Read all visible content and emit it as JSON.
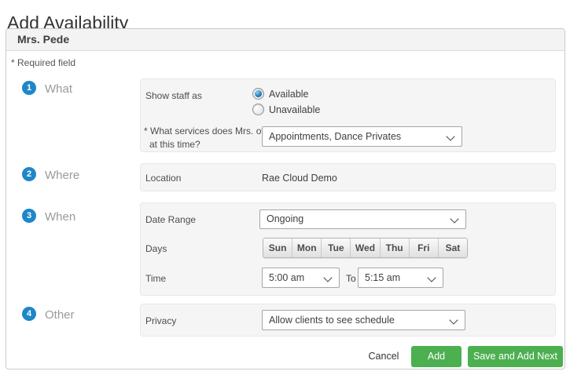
{
  "page": {
    "title": "Add Availability"
  },
  "panel": {
    "header_title": "Mrs. Pede",
    "required_note": "* Required field",
    "sections": [
      {
        "number": "1",
        "label": "What"
      },
      {
        "number": "2",
        "label": "Where"
      },
      {
        "number": "3",
        "label": "When"
      },
      {
        "number": "4",
        "label": "Other"
      }
    ]
  },
  "what": {
    "show_staff_label": "Show staff as",
    "options": [
      {
        "label": "Available",
        "selected": true
      },
      {
        "label": "Unavailable",
        "selected": false
      }
    ],
    "services_question_line1": "* What services does Mrs. offer",
    "services_question_line2": "at this time?",
    "services_selected": "Appointments, Dance Privates"
  },
  "where": {
    "location_label": "Location",
    "location_value": "Rae Cloud Demo"
  },
  "when": {
    "date_range_label": "Date Range",
    "date_range_selected": "Ongoing",
    "days_label": "Days",
    "days": [
      "Sun",
      "Mon",
      "Tue",
      "Wed",
      "Thu",
      "Fri",
      "Sat"
    ],
    "time_label": "Time",
    "time_start_selected": "5:00 am",
    "time_to_label": "To",
    "time_end_selected": "5:15 am"
  },
  "other": {
    "privacy_label": "Privacy",
    "privacy_selected": "Allow clients to see schedule"
  },
  "actions": {
    "cancel_label": "Cancel",
    "add_label": "Add",
    "save_add_next_label": "Save and Add Next"
  },
  "colors": {
    "accent_blue": "#1E87C7",
    "button_green": "#4CAF50"
  }
}
